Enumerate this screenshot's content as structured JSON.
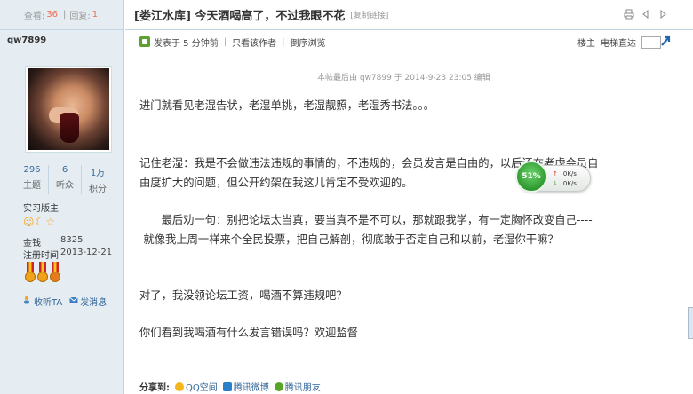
{
  "left": {
    "views_label": "查看:",
    "views": "36",
    "replies_label": "回复:",
    "replies": "1",
    "author": "qw7899",
    "stats": [
      {
        "value": "296",
        "label": "主题"
      },
      {
        "value": "6",
        "label": "听众"
      },
      {
        "value": "1万",
        "label": "积分"
      }
    ],
    "group": "实习版主",
    "info": [
      {
        "key": "金钱",
        "value": "8325"
      },
      {
        "key": "注册时间",
        "value": "2013-12-21"
      }
    ],
    "follow_label": "收听TA",
    "message_label": "发消息"
  },
  "thread": {
    "title": "[娄江水库] 今天酒喝高了，不过我眼不花",
    "copy_link": "[复制链接]"
  },
  "post_head": {
    "posted": "发表于 5 分钟前",
    "only_author": "只看该作者",
    "reverse": "倒序浏览",
    "floor": "楼主",
    "jump_label": "电梯直达"
  },
  "edit_note": "本帖最后由 qw7899 于 2014-9-23 23:05 编辑",
  "body": {
    "p1": "进门就看见老湿告状，老湿单挑，老湿靓照，老湿秀书法。。。",
    "p2a": "记住老湿：我是不会做违法违规的事情的，不违规的，会员发言是自由的，以后还在考虑会员自",
    "p2b": "由度扩大的问题，但公开约架在我这儿肯定不受欢迎的。",
    "p3a": "　　最后劝一句：别把论坛太当真，要当真不是不可以，那就跟我学，有一定胸怀改变自己----",
    "p3b": "-就像我上周一样来个全民投票，把自己解剖，彻底敢于否定自己和以前，老湿你干嘛？",
    "p4": "对了，我没领论坛工资，喝酒不算违规吧？",
    "p5": "你们看到我喝酒有什么发言错误吗？欢迎监督"
  },
  "share": {
    "label": "分享到:",
    "items": [
      "QQ空间",
      "腾讯微博",
      "腾讯朋友"
    ]
  },
  "speed_widget": {
    "percent": "51%",
    "up": "0K/s",
    "down": "0K/s"
  }
}
